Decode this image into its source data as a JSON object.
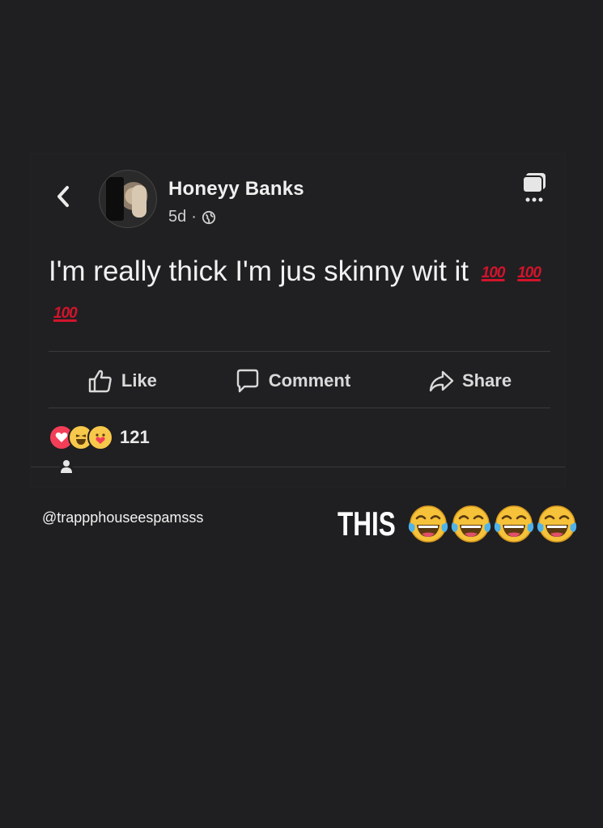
{
  "post": {
    "author": "Honeyy Banks",
    "timestamp": "5d",
    "separator": "·",
    "privacy_icon": "globe-icon",
    "text": "I'm really thick I'm jus skinny wit it",
    "emoji_run": [
      "100",
      "100",
      "100"
    ],
    "actions": {
      "like_label": "Like",
      "comment_label": "Comment",
      "share_label": "Share"
    },
    "reactions": {
      "icons": [
        "love-reaction-icon",
        "haha-reaction-icon",
        "care-reaction-icon"
      ],
      "count": "121"
    }
  },
  "watermark": "@trappphouseespamsss",
  "caption": {
    "text": "THIS",
    "emoji_count": 4,
    "emoji": "tears-of-joy"
  },
  "colors": {
    "background": "#1f1f21",
    "hundred_red": "#d2142b",
    "emoji_yellow": "#f6c23a"
  }
}
